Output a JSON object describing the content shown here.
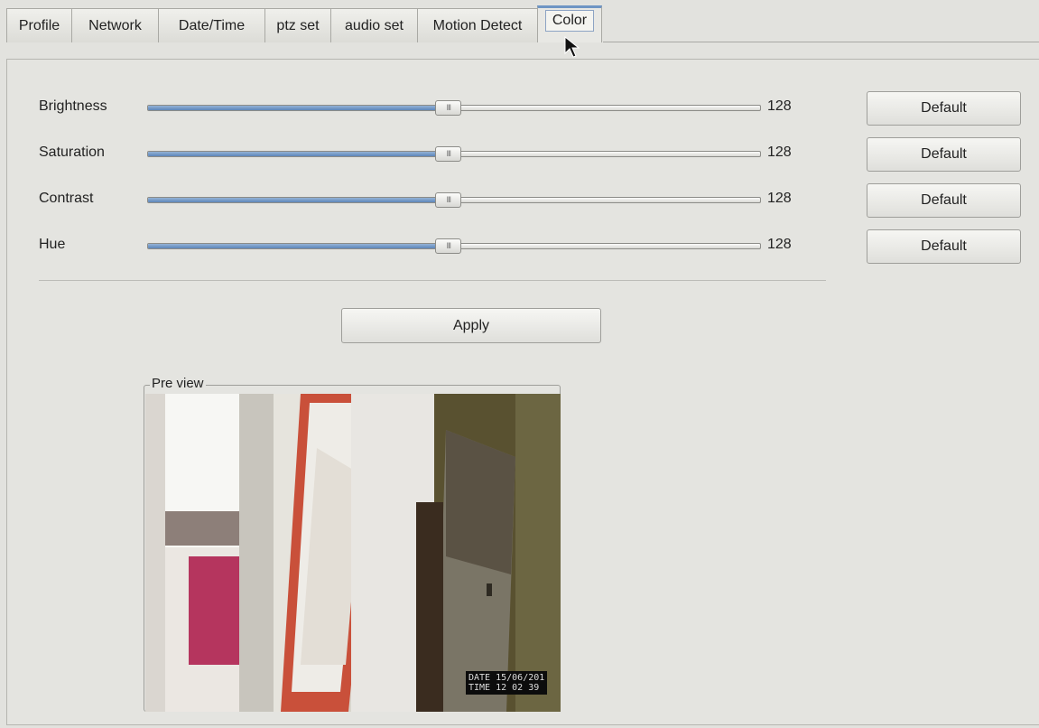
{
  "tabs": [
    {
      "label": "Profile"
    },
    {
      "label": "Network"
    },
    {
      "label": "Date/Time"
    },
    {
      "label": "ptz set"
    },
    {
      "label": "audio set"
    },
    {
      "label": "Motion Detect"
    },
    {
      "label": "Color",
      "active": true
    }
  ],
  "sliders": [
    {
      "label": "Brightness",
      "value": "128",
      "min": 0,
      "max": 255,
      "default_label": "Default"
    },
    {
      "label": "Saturation",
      "value": "128",
      "min": 0,
      "max": 255,
      "default_label": "Default"
    },
    {
      "label": "Contrast",
      "value": "128",
      "min": 0,
      "max": 255,
      "default_label": "Default"
    },
    {
      "label": "Hue",
      "value": "128",
      "min": 0,
      "max": 255,
      "default_label": "Default"
    }
  ],
  "slider_grip": "III",
  "apply_label": "Apply",
  "preview": {
    "title": "Pre view",
    "osd_date": "DATE 15/06/201",
    "osd_time": "TIME 12 02 39"
  },
  "colors": {
    "accent": "#6f95c4",
    "slider_fill": "#5c86ba",
    "background": "#e2e2de"
  },
  "icons": [
    "mouse-pointer-icon"
  ]
}
